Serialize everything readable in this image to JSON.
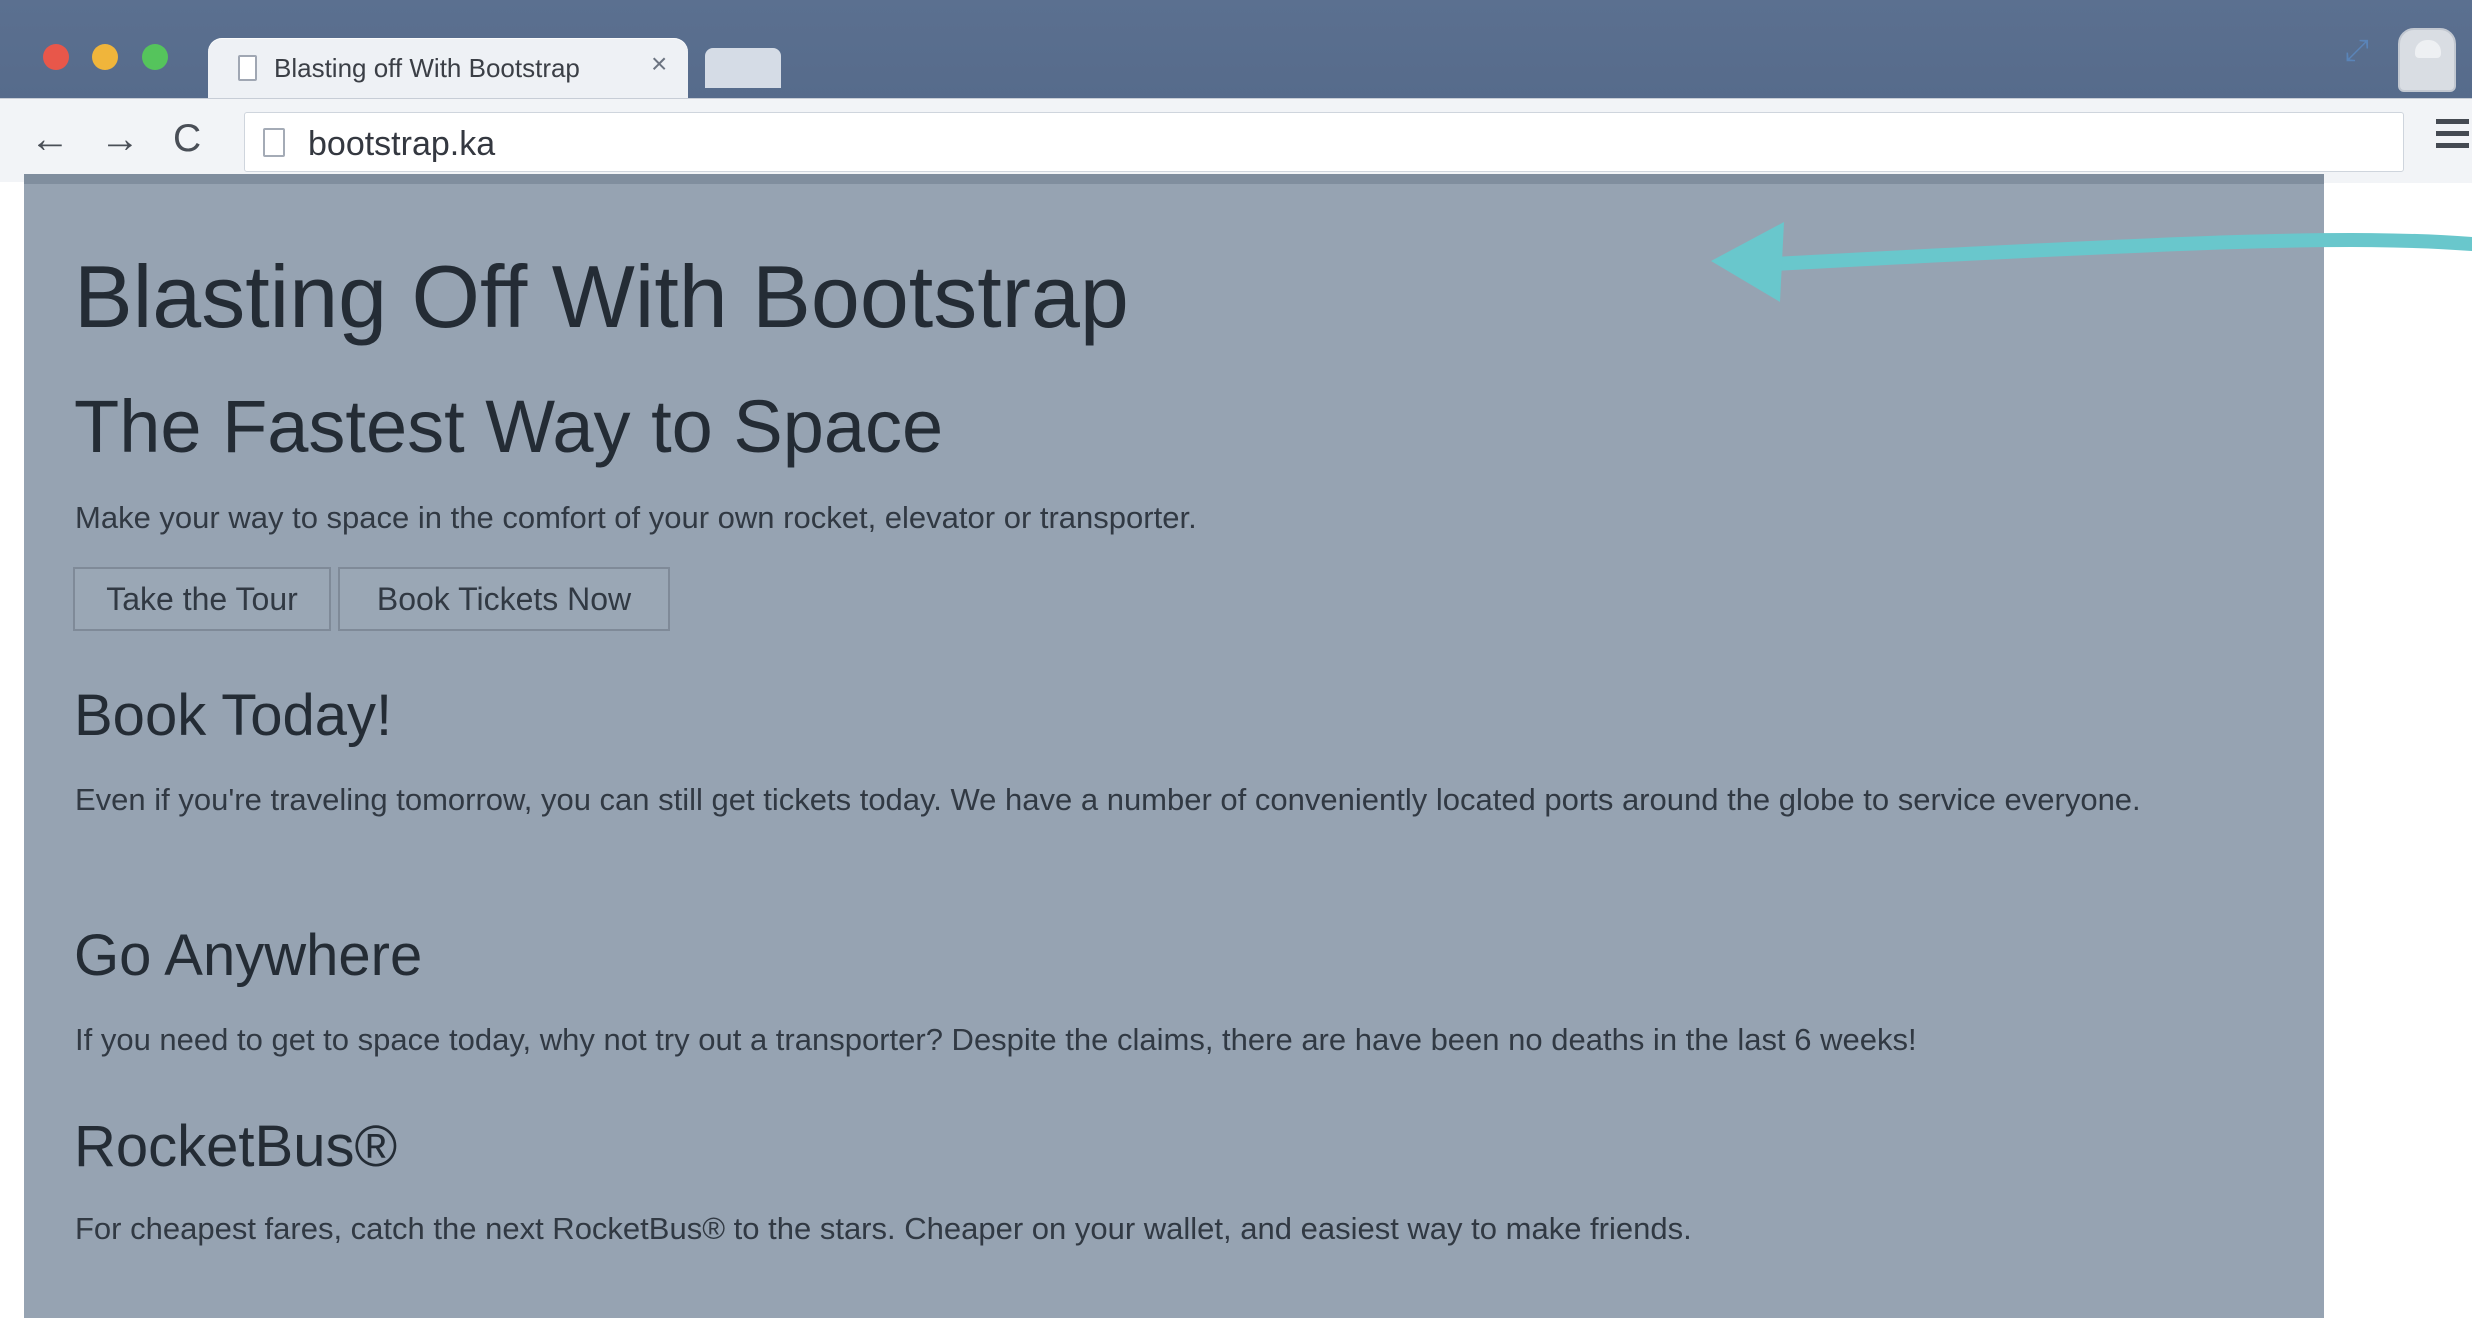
{
  "browser": {
    "tab_title": "Blasting off With Bootstrap",
    "tab_close": "×",
    "address": "bootstrap.ka",
    "nav": {
      "back": "←",
      "forward": "→",
      "reload": "C"
    }
  },
  "page": {
    "title": "Blasting Off With Bootstrap",
    "hero": {
      "subtitle": "The Fastest Way to Space",
      "text": "Make your way to space in the comfort of your own rocket, elevator or transporter.",
      "buttons": [
        "Take the Tour",
        "Book Tickets Now"
      ]
    },
    "sections": [
      {
        "title": "Book Today!",
        "text": "Even if you're traveling tomorrow, you can still get tickets today. We have a number of conveniently located ports around the globe to service everyone."
      },
      {
        "title": "Go Anywhere",
        "text": "If you need to get to space today, why not try out a transporter? Despite the claims, there are have been no deaths in the last 6 weeks!"
      },
      {
        "title": "RocketBus®",
        "text": "For cheapest fares, catch the next RocketBus® to the stars. Cheaper on your wallet, and easiest way to make friends."
      }
    ]
  },
  "icons": {
    "page": "page-icon",
    "menu": "hamburger-menu-icon",
    "avatar": "user-avatar-icon",
    "annotation": "arrow-icon"
  },
  "colors": {
    "viewport_overlay": "#96a3b2",
    "annotation_arrow": "#69c7cc",
    "titlebar": "#5b7090"
  }
}
